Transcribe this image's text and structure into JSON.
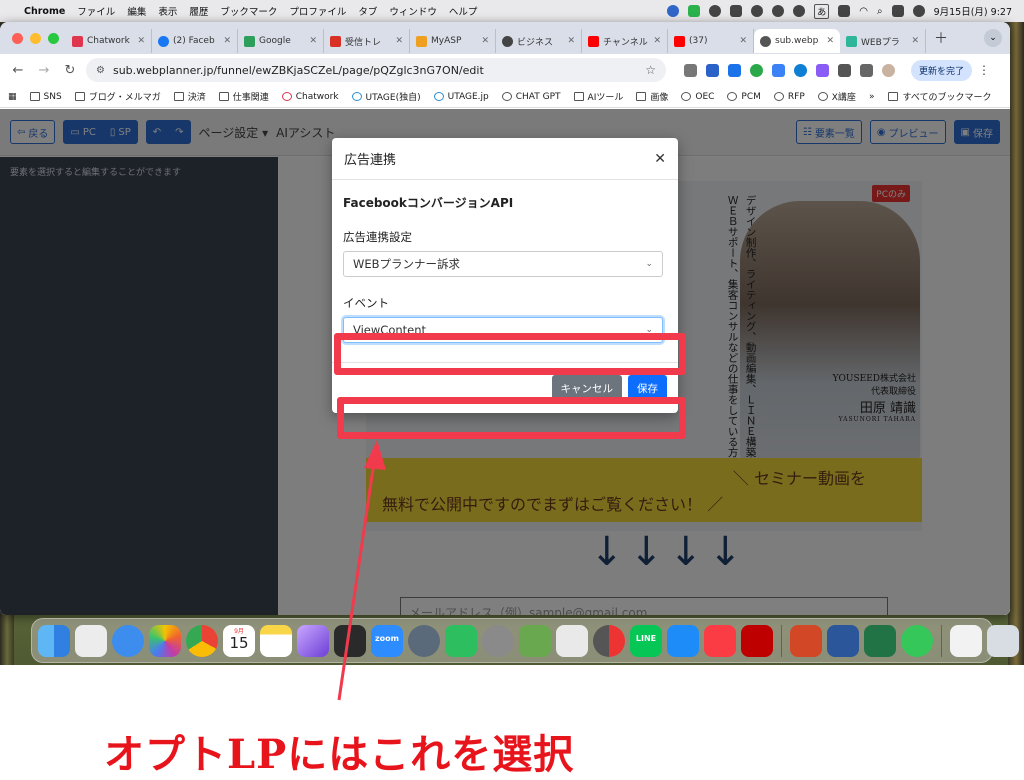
{
  "menubar": {
    "app": "Chrome",
    "items": [
      "ファイル",
      "編集",
      "表示",
      "履歴",
      "ブックマーク",
      "プロファイル",
      "タブ",
      "ウィンドウ",
      "ヘルプ"
    ],
    "ime": "あ",
    "datetime": "9月15日(月)  9:27"
  },
  "tabs": [
    {
      "label": "Chatwork",
      "color": "#e0364d"
    },
    {
      "label": "(2) Faceb",
      "color": "#1877f2"
    },
    {
      "label": "Google",
      "color": "#2e9e5b"
    },
    {
      "label": "受信トレ",
      "color": "#d93025"
    },
    {
      "label": "MyASP",
      "color": "#f0a020"
    },
    {
      "label": "ビジネス",
      "color": "#444444"
    },
    {
      "label": "チャンネル",
      "color": "#ff0000"
    },
    {
      "label": "(37)",
      "color": "#ff0000"
    },
    {
      "label": "sub.webp",
      "color": "#555555"
    },
    {
      "label": "WEBプラ",
      "color": "#2fb59a"
    }
  ],
  "toolbar": {
    "url": "sub.webplanner.jp/funnel/ewZBKjaSCZeL/page/pQZglc3nG7ON/edit",
    "update": "更新を完了"
  },
  "bookmarks": [
    "SNS",
    "ブログ・メルマガ",
    "決済",
    "仕事関連",
    "Chatwork",
    "UTAGE(独自)",
    "UTAGE.jp",
    "CHAT GPT",
    "AIツール",
    "画像",
    "OEC",
    "PCM",
    "RFP",
    "X講座"
  ],
  "bookmarks_more": "すべてのブックマーク",
  "editor": {
    "back": "戻る",
    "pc": "PC",
    "sp": "SP",
    "page_settings": "ページ設定 ▾",
    "ai_assist": "AIアシスト",
    "elements": "要素一覧",
    "preview": "プレビュー",
    "save": "保存",
    "sidebar_hint": "要素を選択すると編集することができます"
  },
  "hero": {
    "badge": "PCのみ",
    "vertical_lines": [
      "デザイン制作、ライティング、動画編集、ＬＩＮＥ構築、",
      "ＷＥＢサポート、集客コンサルなどの仕事をしている方"
    ],
    "company": "YOUSEED株式会社",
    "title": "代表取締役",
    "name": "田原 靖識",
    "romaji": "YASUNORI TAHARA",
    "banner_line1": "＼  セミナー動画を",
    "banner_line2": "無料で公開中ですのでまずはご覧ください！  ／",
    "email_placeholder": "メールアドレス（例）sample@gmail.com"
  },
  "modal": {
    "title": "広告連携",
    "subtitle": "FacebookコンバージョンAPI",
    "setting_label": "広告連携設定",
    "setting_value": "WEBプランナー訴求",
    "event_label": "イベント",
    "event_value": "ViewContent",
    "cancel": "キャンセル",
    "save": "保存"
  },
  "dock": {
    "calendar_month": "9月",
    "calendar_day": "15",
    "zoom": "zoom",
    "line": "LINE"
  },
  "annotation": {
    "caption": "オプトLPにはこれを選択",
    "color": "#e8141c"
  }
}
